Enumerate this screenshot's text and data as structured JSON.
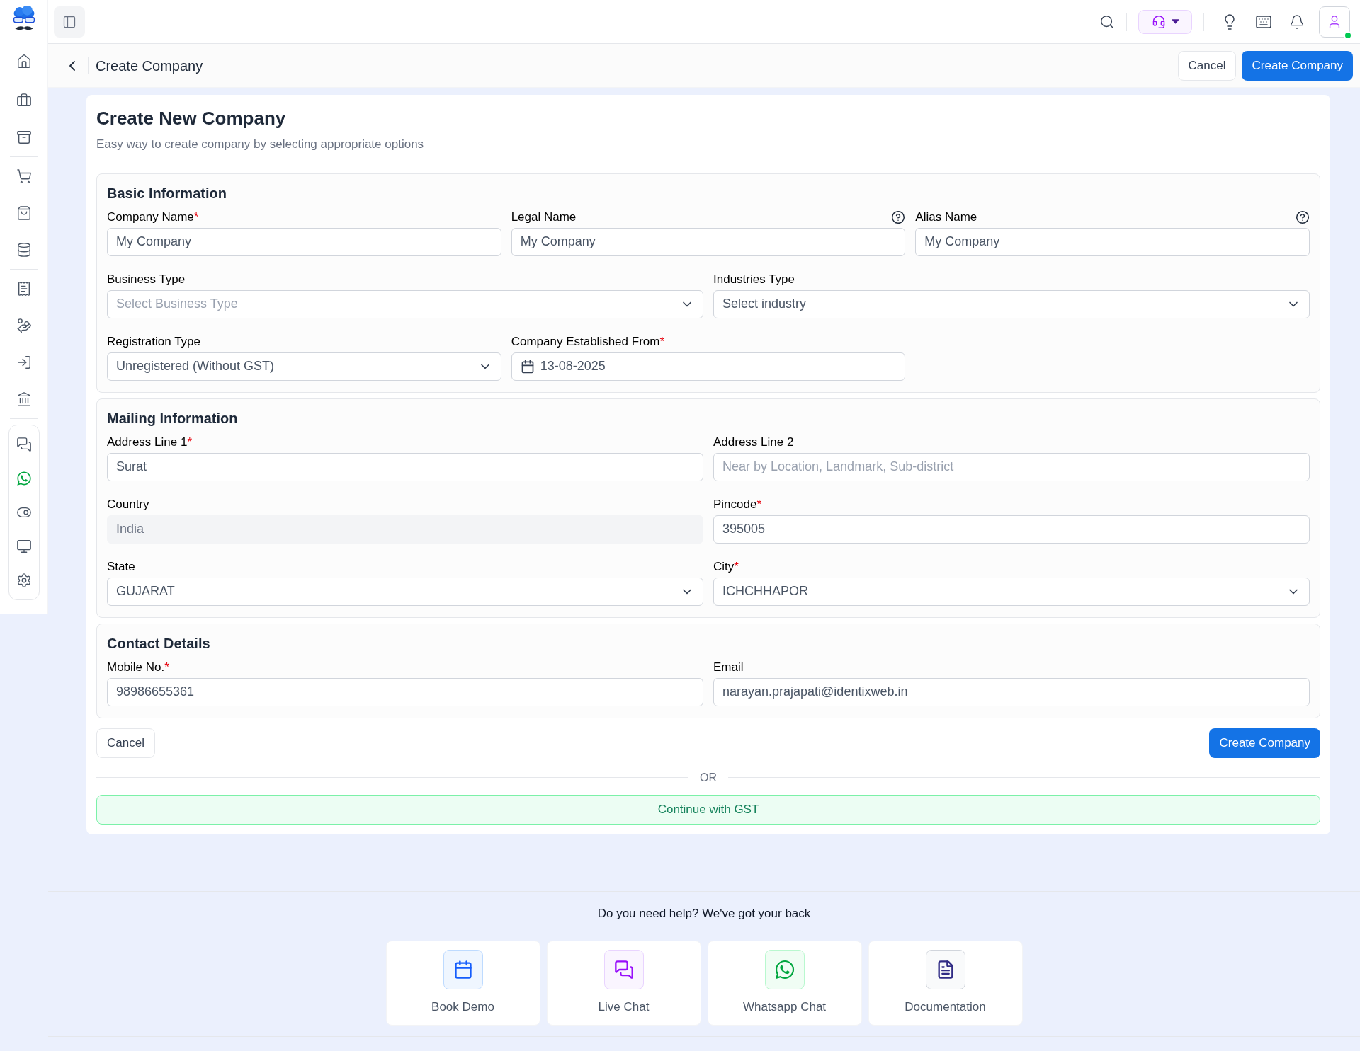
{
  "header": {
    "title": "Create Company",
    "cancel": "Cancel",
    "submit": "Create Company"
  },
  "form": {
    "title": "Create New Company",
    "subtitle": "Easy way to create company by selecting appropriate options",
    "sections": [
      {
        "title": "Basic Information",
        "rows": [
          [
            {
              "label": "Company Name",
              "mark": "*",
              "kind": "text",
              "value": "My Company"
            },
            {
              "label": "Legal Name",
              "kind": "text",
              "value": "My Company",
              "help": true
            },
            {
              "label": "Alias Name",
              "kind": "text",
              "value": "My Company",
              "help": true
            }
          ],
          [
            {
              "label": "Business Type",
              "kind": "select",
              "placeholder": "Select Business Type"
            },
            {
              "label": "Industries Type",
              "kind": "select",
              "value": "Select industry"
            }
          ],
          [
            {
              "label": "Registration Type",
              "kind": "select",
              "value": "Unregistered (Without GST)"
            },
            {
              "label": "Company Established From",
              "mark": "*",
              "kind": "date",
              "value": "13-08-2025"
            }
          ]
        ]
      },
      {
        "title": "Mailing Information",
        "rows": [
          [
            {
              "label": "Address Line 1",
              "mark": "*",
              "kind": "text",
              "value": "Surat"
            },
            {
              "label": "Address Line 2",
              "kind": "text",
              "placeholder": "Near by Location, Landmark, Sub-district"
            }
          ],
          [
            {
              "label": "Country",
              "kind": "disabled",
              "value": "India"
            },
            {
              "label": "Pincode",
              "mark": "*",
              "kind": "text",
              "value": "395005"
            }
          ],
          [
            {
              "label": "State",
              "kind": "select",
              "value": "GUJARAT"
            },
            {
              "label": "City",
              "mark": "*",
              "kind": "select",
              "value": "ICHCHHAPOR"
            }
          ]
        ]
      },
      {
        "title": "Contact Details",
        "rows": [
          [
            {
              "label": "Mobile No.",
              "mark": "*",
              "kind": "text",
              "value": "98986655361"
            },
            {
              "label": "Email",
              "kind": "text",
              "value": "narayan.prajapati@identixweb.in"
            }
          ]
        ]
      }
    ],
    "cancel": "Cancel",
    "submit": "Create Company",
    "divider": "OR",
    "gst": "Continue with GST"
  },
  "help": {
    "title": "Do you need help? We've got your back",
    "items": [
      {
        "kind": "calendar",
        "label": "Book Demo"
      },
      {
        "kind": "chat",
        "label": "Live Chat"
      },
      {
        "kind": "whatsapp",
        "label": "Whatsapp Chat"
      },
      {
        "kind": "doc",
        "label": "Documentation"
      }
    ]
  }
}
